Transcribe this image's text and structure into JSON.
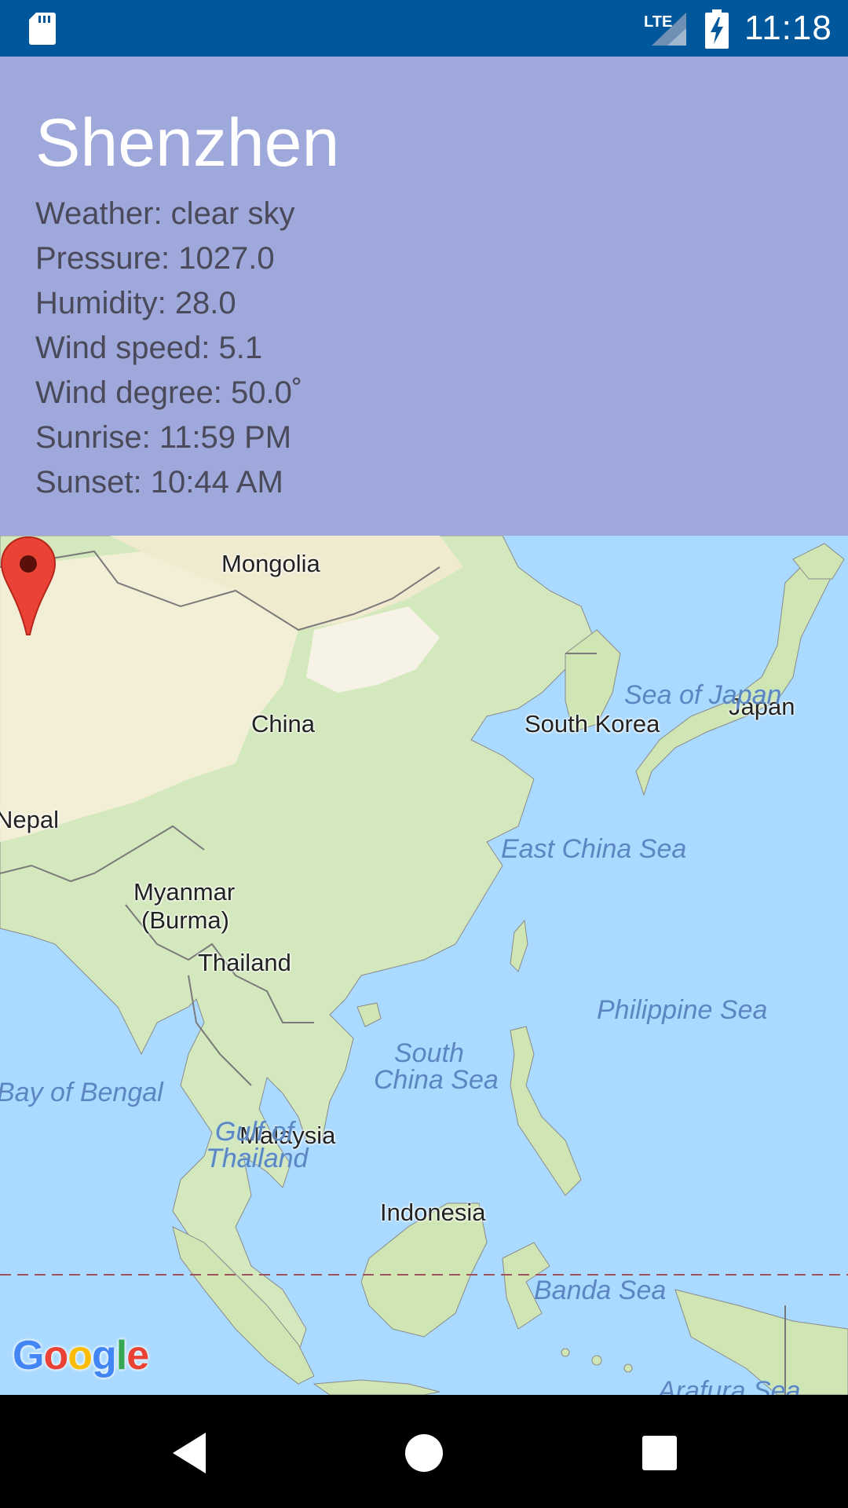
{
  "status_bar": {
    "time": "11:18",
    "network": "LTE",
    "icons": [
      "sd-card-icon",
      "lte-signal-icon",
      "battery-charging-icon"
    ]
  },
  "weather": {
    "city": "Shenzhen",
    "lines": [
      "Weather: clear sky",
      "Pressure: 1027.0",
      "Humidity: 28.0",
      "Wind speed: 5.1",
      "Wind degree: 50.0˚",
      "Sunrise: 11:59 PM",
      "Sunset: 10:44 AM"
    ]
  },
  "map": {
    "country_labels": {
      "mongolia": "Mongolia",
      "china": "China",
      "south_korea": "South Korea",
      "japan": "Japan",
      "nepal": "Nepal",
      "myanmar_1": "Myanmar",
      "myanmar_2": "(Burma)",
      "thailand": "Thailand",
      "malaysia": "Malaysia",
      "indonesia": "Indonesia"
    },
    "sea_labels": {
      "sea_of_japan": "Sea of Japan",
      "east_china_sea": "East China Sea",
      "philippine_sea": "Philippine Sea",
      "south_china_sea_1": "South",
      "south_china_sea_2": "China Sea",
      "bay_of_bengal": "Bay of Bengal",
      "gulf_of_thailand_1": "Gulf of",
      "gulf_of_thailand_2": "Thailand",
      "banda_sea": "Banda Sea",
      "arafura_sea": "Arafura Sea"
    },
    "attribution": "Google",
    "marker_icon": "map-pin-icon"
  },
  "colors": {
    "status_bar": "#01579b",
    "panel": "#9fa8da",
    "water": "#aadaff",
    "land": "#cfe6b4",
    "marker": "#ea4335"
  },
  "nav_bar": {
    "icons": [
      "back-icon",
      "home-icon",
      "recents-icon"
    ]
  }
}
